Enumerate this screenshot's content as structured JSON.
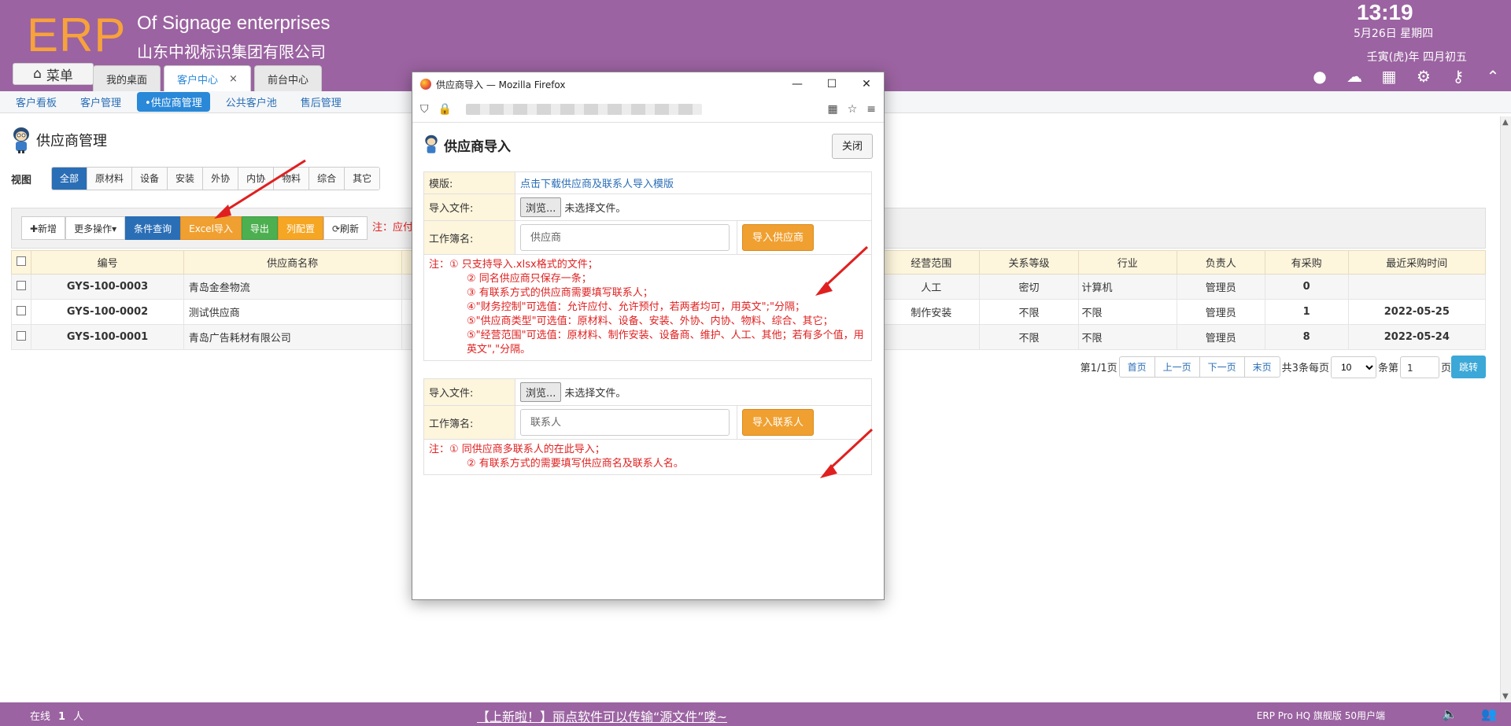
{
  "header": {
    "logo": "ERP",
    "org_en": "Of Signage enterprises",
    "org_cn": "山东中视标识集团有限公司",
    "time": "13:19",
    "date": "5月26日 星期四",
    "lunar": "壬寅(虎)年 四月初五",
    "menu_label": "菜单",
    "tabs": [
      {
        "label": "我的桌面"
      },
      {
        "label": "客户中心",
        "close": "×"
      },
      {
        "label": "前台中心"
      }
    ]
  },
  "subnav": [
    "客户看板",
    "客户管理",
    "•供应商管理",
    "公共客户池",
    "售后管理"
  ],
  "page": {
    "title": "供应商管理",
    "view_label": "视图",
    "views": [
      "全部",
      "原材料",
      "设备",
      "安装",
      "外协",
      "内协",
      "物料",
      "综合",
      "其它"
    ]
  },
  "toolbar": {
    "add": "✚新增",
    "more": "更多操作▾",
    "query": "条件查询",
    "excel_import": "Excel导入",
    "export": "导出",
    "columns": "列配置",
    "refresh": "⟳刷新",
    "note": "注：应付"
  },
  "table": {
    "headers": [
      "编号",
      "供应商名称",
      "经营范围",
      "关系等级",
      "行业",
      "负责人",
      "有采购",
      "最近采购时间"
    ],
    "rows": [
      {
        "code": "GYS-100-0003",
        "name": "青岛金叁物流",
        "scope": "人工",
        "level": "密切",
        "industry": "计算机",
        "owner": "管理员",
        "purchase": "0",
        "last": ""
      },
      {
        "code": "GYS-100-0002",
        "name": "测试供应商",
        "scope": "制作安装",
        "level": "不限",
        "industry": "不限",
        "owner": "管理员",
        "purchase": "1",
        "last": "2022-05-25"
      },
      {
        "code": "GYS-100-0001",
        "name": "青岛广告耗材有限公司",
        "scope": "",
        "level": "不限",
        "industry": "不限",
        "owner": "管理员",
        "purchase": "8",
        "last": "2022-05-24"
      }
    ]
  },
  "pager": {
    "page_info": "第1/1页",
    "first": "首页",
    "prev": "上一页",
    "next": "下一页",
    "last": "末页",
    "total": "共3条每页",
    "per_page": "10",
    "per_unit": "条第",
    "page_input": "1",
    "page_unit": "页",
    "go": "跳转"
  },
  "footer": {
    "online_pre": "在线",
    "online_count": "1",
    "online_post": "人",
    "news": "【上新啦！】丽点软件可以传输“源文件”喽~",
    "version": "ERP Pro HQ 旗舰版 50用户端"
  },
  "popup": {
    "window_title": "供应商导入 — Mozilla Firefox",
    "heading": "供应商导入",
    "close": "关闭",
    "template_label": "模版:",
    "template_link": "点击下载供应商及联系人导入模版",
    "file_label": "导入文件:",
    "browse": "浏览...",
    "no_file": "未选择文件。",
    "sheet_label": "工作簿名:",
    "supplier_sheet": "供应商",
    "import_supplier": "导入供应商",
    "notes1": [
      "注：① 只支持导入.xlsx格式的文件；",
      "② 同名供应商只保存一条；",
      "③ 有联系方式的供应商需要填写联系人；",
      "④\"财务控制\"可选值：允许应付、允许预付，若两者均可，用英文\";\"分隔；",
      "⑤\"供应商类型\"可选值：原材料、设备、安装、外协、内协、物料、综合、其它；",
      "⑤\"经营范围\"可选值：原材料、制作安装、设备商、维护、人工、其他；若有多个值，用英文\",\"分隔。"
    ],
    "contact_sheet": "联系人",
    "import_contact": "导入联系人",
    "notes2": [
      "注：① 同供应商多联系人的在此导入；",
      "② 有联系方式的需要填写供应商名及联系人名。"
    ]
  }
}
